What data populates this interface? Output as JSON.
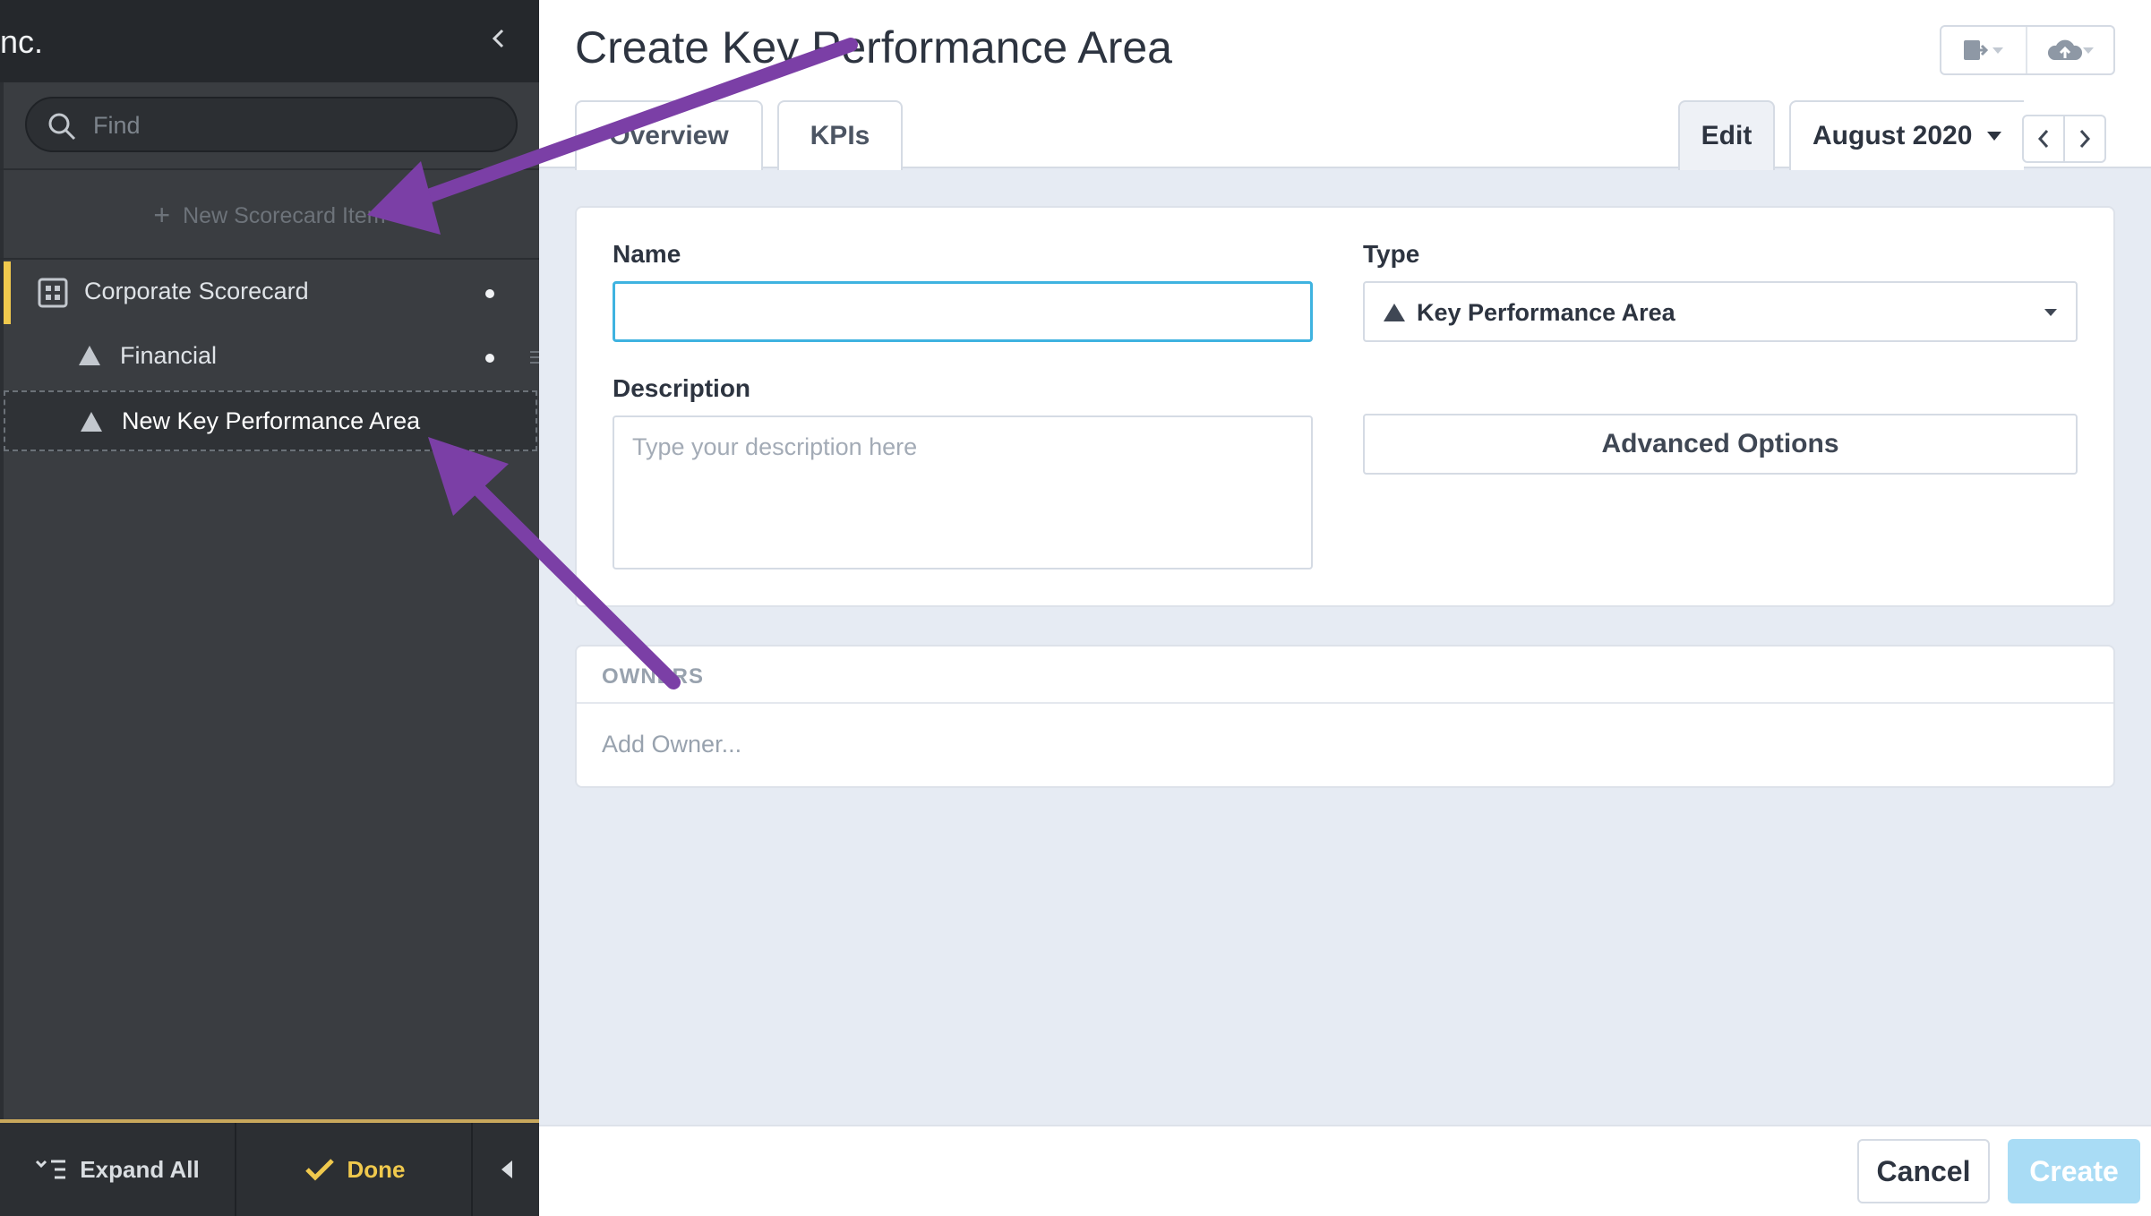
{
  "sidebar": {
    "title": "nc.",
    "search_placeholder": "Find",
    "new_item_label": "New Scorecard Item",
    "tree": [
      {
        "label": "Corporate Scorecard",
        "icon": "scorecard-icon"
      },
      {
        "label": "Financial",
        "icon": "triangle-icon"
      },
      {
        "label": "New Key Performance Area",
        "icon": "triangle-icon"
      }
    ],
    "footer": {
      "expand_all": "Expand All",
      "done": "Done"
    }
  },
  "main": {
    "title": "Create Key Performance Area",
    "tabs": [
      {
        "label": "Overview"
      },
      {
        "label": "KPIs"
      }
    ],
    "edit_tab": "Edit",
    "period": "August 2020",
    "form": {
      "name_label": "Name",
      "name_value": "",
      "type_label": "Type",
      "type_value": "Key Performance Area",
      "description_label": "Description",
      "description_placeholder": "Type your description here",
      "advanced_options": "Advanced Options"
    },
    "owners": {
      "heading": "OWNERS",
      "add_owner": "Add Owner..."
    },
    "footer": {
      "cancel": "Cancel",
      "create": "Create"
    }
  },
  "colors": {
    "accent_yellow": "#f0c94d",
    "focus_blue": "#3fb3e0",
    "create_disabled": "#a9dcf5",
    "arrow_purple": "#7b3fa6"
  }
}
